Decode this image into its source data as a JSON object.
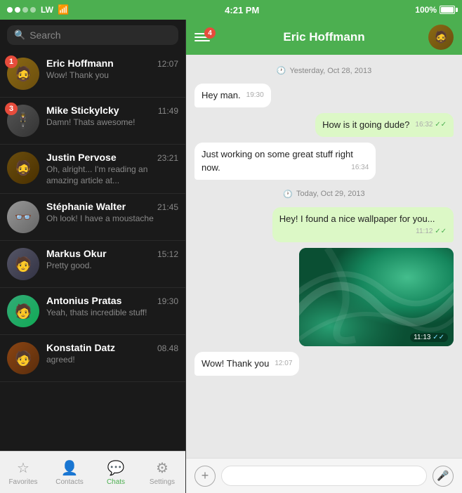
{
  "status_bar": {
    "signal_dots": "●●○○",
    "carrier": "LW",
    "time": "4:21 PM",
    "battery": "100%"
  },
  "search": {
    "placeholder": "Search"
  },
  "chat_list": [
    {
      "id": 1,
      "name": "Eric Hoffmann",
      "time": "12:07",
      "preview": "Wow! Thank you",
      "badge": "1",
      "avatar_emoji": "🧔",
      "avatar_class": "av1"
    },
    {
      "id": 2,
      "name": "Mike Stickylcky",
      "time": "11:49",
      "preview": "Damn! Thats awesome!",
      "badge": "3",
      "avatar_emoji": "🕺",
      "avatar_class": "av2"
    },
    {
      "id": 3,
      "name": "Justin Pervose",
      "time": "23:21",
      "preview": "Oh, alright... I'm reading an amazing article at...",
      "badge": null,
      "avatar_emoji": "🧔",
      "avatar_class": "av3"
    },
    {
      "id": 4,
      "name": "Stéphanie Walter",
      "time": "21:45",
      "preview": "Oh look! I have a moustache",
      "badge": null,
      "avatar_emoji": "👩",
      "avatar_class": "av4"
    },
    {
      "id": 5,
      "name": "Markus Okur",
      "time": "15:12",
      "preview": "Pretty good.",
      "badge": null,
      "avatar_emoji": "🧑",
      "avatar_class": "av5"
    },
    {
      "id": 6,
      "name": "Antonius Pratas",
      "time": "19:30",
      "preview": "Yeah, thats incredible stuff!",
      "badge": null,
      "avatar_emoji": "👤",
      "avatar_class": "av6"
    },
    {
      "id": 7,
      "name": "Konstatin Datz",
      "time": "08.48",
      "preview": "agreed!",
      "badge": null,
      "avatar_emoji": "👤",
      "avatar_class": "av7"
    }
  ],
  "bottom_nav": [
    {
      "id": "favorites",
      "label": "Favorites",
      "icon": "☆",
      "active": false
    },
    {
      "id": "contacts",
      "label": "Contacts",
      "icon": "👤",
      "active": false
    },
    {
      "id": "chats",
      "label": "Chats",
      "icon": "💬",
      "active": true
    },
    {
      "id": "settings",
      "label": "Settings",
      "icon": "⚙",
      "active": false
    }
  ],
  "chat_header": {
    "menu_badge": "4",
    "contact_name": "Eric Hoffmann"
  },
  "messages": [
    {
      "type": "date-sep",
      "text": "Yesterday, Oct 28, 2013"
    },
    {
      "type": "received",
      "text": "Hey man.",
      "time": "19:30"
    },
    {
      "type": "sent",
      "text": "How is it going dude?",
      "time": "16:32",
      "ticks": "✓✓"
    },
    {
      "type": "received",
      "text": "Just working on some great stuff right now.",
      "time": "16:34"
    },
    {
      "type": "date-sep",
      "text": "Today, Oct 29, 2013"
    },
    {
      "type": "sent",
      "text": "Hey! I found a nice wallpaper for you...",
      "time": "11:12",
      "ticks": "✓✓"
    },
    {
      "type": "sent-image",
      "time": "11:13",
      "ticks": "✓✓"
    },
    {
      "type": "received",
      "text": "Wow! Thank you",
      "time": "12:07"
    }
  ],
  "input": {
    "placeholder": ""
  }
}
